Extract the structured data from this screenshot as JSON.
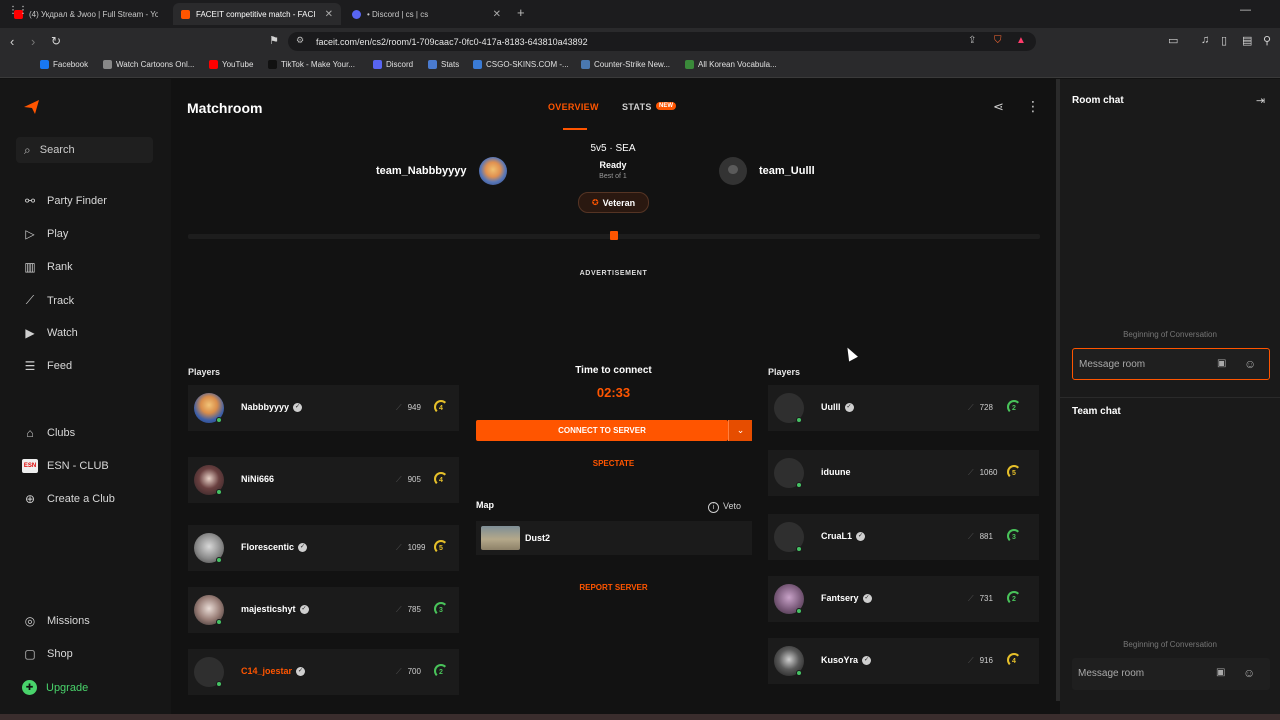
{
  "browser": {
    "tabs": [
      {
        "title": "(4) Укдрал & Jwoo | Full Stream - Yo",
        "color": "#ff0000"
      },
      {
        "title": "FACEIT competitive match - FACI",
        "color": "#ff5500"
      },
      {
        "title": "• Discord | cs | cs",
        "color": "#5865f2"
      }
    ],
    "url": "faceit.com/en/cs2/room/1-709caac7-0fc0-417a-8183-643810a43892",
    "bookmarks": [
      {
        "label": "Facebook",
        "icon": "facebook-icon",
        "color": "#1877f2"
      },
      {
        "label": "Watch Cartoons Onl...",
        "icon": "globe-icon",
        "color": "#888888"
      },
      {
        "label": "YouTube",
        "icon": "youtube-icon",
        "color": "#ff0000"
      },
      {
        "label": "TikTok - Make Your...",
        "icon": "tiktok-icon",
        "color": "#111111"
      },
      {
        "label": "Discord",
        "icon": "discord-icon",
        "color": "#5865f2"
      },
      {
        "label": "Stats",
        "icon": "stats-icon",
        "color": "#4a7bd0"
      },
      {
        "label": "CSGO-SKINS.COM -...",
        "icon": "skins-icon",
        "color": "#3a7bd5"
      },
      {
        "label": "Counter-Strike New...",
        "icon": "cs-icon",
        "color": "#4a78b0"
      },
      {
        "label": "All Korean Vocabula...",
        "icon": "korean-icon",
        "color": "#3a8a3a"
      }
    ]
  },
  "sidebar": {
    "search": "Search",
    "items": [
      {
        "label": "Party Finder",
        "icon": "party-finder-icon",
        "glyph": "⚯"
      },
      {
        "label": "Play",
        "icon": "play-icon",
        "glyph": "▷"
      },
      {
        "label": "Rank",
        "icon": "rank-icon",
        "glyph": "▥"
      },
      {
        "label": "Track",
        "icon": "track-icon",
        "glyph": "⟋"
      },
      {
        "label": "Watch",
        "icon": "watch-icon",
        "glyph": "▶"
      },
      {
        "label": "Feed",
        "icon": "feed-icon",
        "glyph": "☰"
      },
      {
        "label": "Clubs",
        "icon": "clubs-icon",
        "glyph": "⌂"
      },
      {
        "label": "ESN - CLUB",
        "icon": "esn-club-icon",
        "glyph": "◼"
      },
      {
        "label": "Create a Club",
        "icon": "create-club-icon",
        "glyph": "⊕"
      },
      {
        "label": "Missions",
        "icon": "missions-icon",
        "glyph": "◎"
      },
      {
        "label": "Shop",
        "icon": "shop-icon",
        "glyph": "▢"
      },
      {
        "label": "Upgrade",
        "icon": "upgrade-icon",
        "glyph": "✚"
      }
    ]
  },
  "match": {
    "page_title": "Matchroom",
    "tab_overview": "OVERVIEW",
    "tab_stats": "STATS",
    "new_badge": "NEW",
    "team1": "team_Nabbbyyyy",
    "team2": "team_Uulll",
    "mode": "5v5 · SEA",
    "status": "Ready",
    "best_of": "Best of 1",
    "tier": "Veteran",
    "advertisement": "ADVERTISEMENT",
    "players_label": "Players",
    "time_to_connect": "Time to connect",
    "timer": "02:33",
    "connect": "CONNECT TO SERVER",
    "spectate": "SPECTATE",
    "map_label": "Map",
    "veto": "Veto",
    "map": "Dust2",
    "report": "REPORT SERVER",
    "accent": "#ff5500"
  },
  "players_left": [
    {
      "name": "Nabbbyyyy",
      "elo": "949",
      "level": "4",
      "verified": true,
      "orange": false
    },
    {
      "name": "NiNi666",
      "elo": "905",
      "level": "4",
      "verified": false,
      "orange": false
    },
    {
      "name": "Florescentic",
      "elo": "1099",
      "level": "5",
      "verified": true,
      "orange": false
    },
    {
      "name": "majesticshyt",
      "elo": "785",
      "level": "3",
      "verified": true,
      "orange": false
    },
    {
      "name": "C14_joestar",
      "elo": "700",
      "level": "2",
      "verified": true,
      "orange": true
    }
  ],
  "players_right": [
    {
      "name": "Uulll",
      "elo": "728",
      "level": "2",
      "verified": true,
      "orange": false
    },
    {
      "name": "iduune",
      "elo": "1060",
      "level": "5",
      "verified": false,
      "orange": false
    },
    {
      "name": "CruaL1",
      "elo": "881",
      "level": "3",
      "verified": true,
      "orange": false
    },
    {
      "name": "Fantsery",
      "elo": "731",
      "level": "2",
      "verified": true,
      "orange": false
    },
    {
      "name": "KusoYra",
      "elo": "916",
      "level": "4",
      "verified": true,
      "orange": false
    }
  ],
  "chat": {
    "room_title": "Room chat",
    "team_title": "Team chat",
    "beginning": "Beginning of Conversation",
    "placeholder": "Message room"
  }
}
